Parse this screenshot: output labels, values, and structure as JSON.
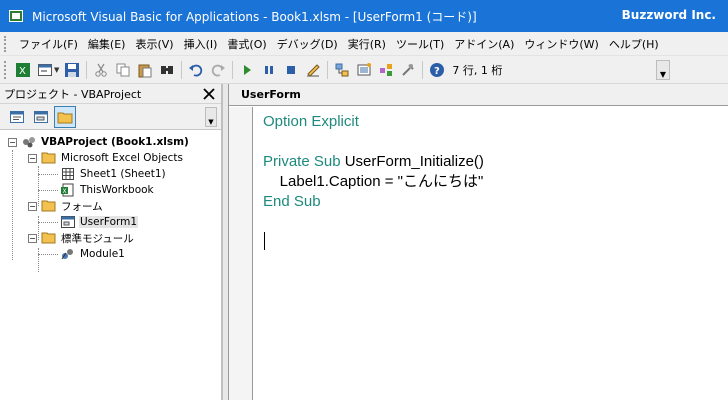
{
  "window": {
    "title": "Microsoft Visual Basic for Applications - Book1.xlsm - [UserForm1 (コード)]",
    "brand": "Buzzword Inc."
  },
  "menu": {
    "items": [
      "ファイル(F)",
      "編集(E)",
      "表示(V)",
      "挿入(I)",
      "書式(O)",
      "デバッグ(D)",
      "実行(R)",
      "ツール(T)",
      "アドイン(A)",
      "ウィンドウ(W)",
      "ヘルプ(H)"
    ]
  },
  "toolbar": {
    "position_label": "7 行, 1 桁"
  },
  "project": {
    "title": "プロジェクト - VBAProject",
    "close_glyph": "✕",
    "tree": {
      "root": "VBAProject (Book1.xlsm)",
      "excel_objects": "Microsoft Excel Objects",
      "sheet1": "Sheet1 (Sheet1)",
      "thisworkbook": "ThisWorkbook",
      "forms": "フォーム",
      "userform1": "UserForm1",
      "modules": "標準モジュール",
      "module1": "Module1"
    }
  },
  "code": {
    "object_selector": "UserForm",
    "lines": {
      "l1_kw": "Option Explicit",
      "l3_kw": "Private Sub",
      "l3_rest": " UserForm_Initialize()",
      "l4": "    Label1.Caption = \"こんにちは\"",
      "l5_kw": "End Sub"
    }
  },
  "colors": {
    "titlebar": "#1a73d6",
    "keyword": "#1e8a7e"
  }
}
